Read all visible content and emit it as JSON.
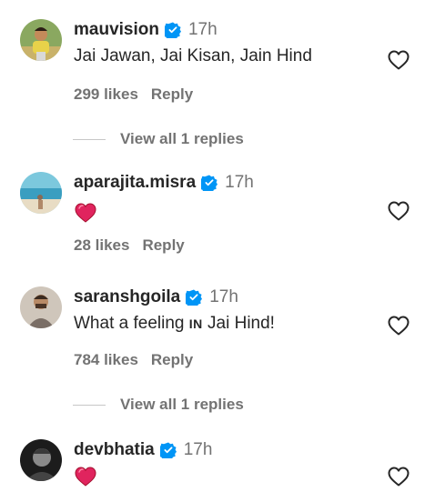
{
  "comments": [
    {
      "username": "mauvision",
      "time": "17h",
      "text": "Jai Jawan, Jai Kisan, Jain Hind",
      "likes": "299 likes",
      "reply": "Reply",
      "view_replies": "View all 1 replies",
      "avatar_color": "#8aa860"
    },
    {
      "username": "aparajita.misra",
      "time": "17h",
      "emoji": "heart",
      "likes": "28 likes",
      "reply": "Reply",
      "avatar_color": "#5fb3c9"
    },
    {
      "username": "saranshgoila",
      "time": "17h",
      "text_before": "What a feeling ",
      "text_smallcaps": "IN",
      "text_after": " Jai Hind!",
      "likes": "784 likes",
      "reply": "Reply",
      "view_replies": "View all 1 replies",
      "avatar_color": "#9a8a7a"
    },
    {
      "username": "devbhatia",
      "time": "17h",
      "emoji": "heart",
      "avatar_color": "#2a2a2a"
    }
  ],
  "colors": {
    "verified_blue": "#0095f6",
    "heart_red": "#e0245e",
    "meta_grey": "#737373"
  },
  "icons": {
    "verified": "verified-badge-icon",
    "like": "heart-outline-icon",
    "emoji": "red-heart-emoji"
  }
}
